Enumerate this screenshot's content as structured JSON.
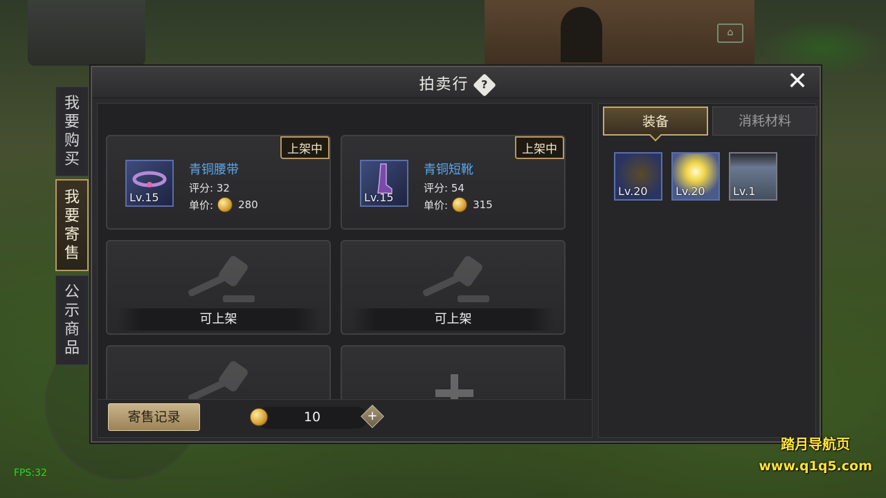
{
  "window_title": "拍卖行",
  "help_icon": "?",
  "close_icon": "✕",
  "side_tabs": [
    {
      "label_chars": [
        "我",
        "要",
        "购",
        "买"
      ],
      "active": false
    },
    {
      "label_chars": [
        "我",
        "要",
        "寄",
        "售"
      ],
      "active": true
    },
    {
      "label_chars": [
        "公",
        "示",
        "商",
        "品"
      ],
      "active": false
    }
  ],
  "slots": [
    {
      "status": "上架中",
      "name": "青铜腰带",
      "score": "评分: 32",
      "price_label": "单价:",
      "price": "280",
      "level": "Lv.15",
      "icon": "belt-icon"
    },
    {
      "status": "上架中",
      "name": "青铜短靴",
      "score": "评分: 54",
      "price_label": "单价:",
      "price": "315",
      "level": "Lv.15",
      "icon": "boots-icon"
    },
    {
      "label": "可上架"
    },
    {
      "label": "可上架"
    }
  ],
  "bottom": {
    "record_button": "寄售记录",
    "money": "10",
    "add_icon": "+"
  },
  "inventory": {
    "tabs": [
      {
        "label": "装备",
        "active": true
      },
      {
        "label": "消耗材料",
        "active": false
      }
    ],
    "items": [
      {
        "level": "Lv.20",
        "icon": "amulet-icon"
      },
      {
        "level": "Lv.20",
        "icon": "staff-icon"
      },
      {
        "level": "Lv.1",
        "icon": "pants-icon"
      }
    ]
  },
  "fps": "FPS:32",
  "watermark": {
    "line1": "踏月导航页",
    "line2": "www.q1q5.com"
  },
  "colors": {
    "accent_gold": "#b89a62",
    "item_name_blue": "#58a6ee",
    "fps_green": "#22dd22",
    "watermark_yellow": "#ffe33a"
  }
}
